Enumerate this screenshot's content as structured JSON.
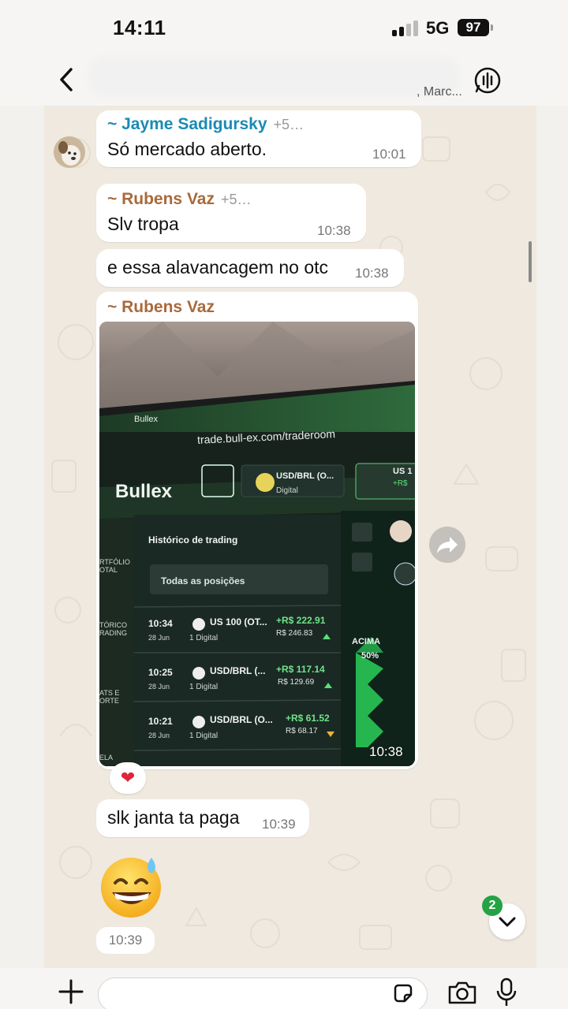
{
  "status_bar": {
    "time": "14:11",
    "network": "5G",
    "battery": "97"
  },
  "header": {
    "subtitle_fragment": ", Marc..."
  },
  "messages": [
    {
      "sender": "~ Jayme Sadigursky",
      "phone_fragment": "+5…",
      "text": "Só mercado aberto.",
      "time": "10:01"
    },
    {
      "sender": "~ Rubens Vaz",
      "phone_fragment": "+5…",
      "text": "Slv tropa",
      "time": "10:38"
    },
    {
      "text": "e essa alavancagem no otc",
      "time": "10:38"
    },
    {
      "sender": "~ Rubens Vaz",
      "time": "10:38",
      "reaction": "❤"
    },
    {
      "text": "slk janta ta paga",
      "time": "10:39"
    },
    {
      "emoji": "grinning-face-with-sweat",
      "time": "10:39"
    }
  ],
  "photo": {
    "tab_title": "Bullex",
    "url": "trade.bull-ex.com/traderoom",
    "logo": "Bullex",
    "asset_tab": {
      "name": "USD/BRL (O...",
      "type": "Digital"
    },
    "asset_tab2": {
      "name": "US 1",
      "value": "+R$"
    },
    "sidebar_labels": [
      "RTFÓLIO\nOTAL",
      "TÓRICO\nRADING",
      "ATS E\nORTE",
      "ELA"
    ],
    "panel_title": "Histórico de trading",
    "filter": "Todas as posições",
    "trades": [
      {
        "time": "10:34",
        "date": "28 Jun",
        "asset": "US 100 (OT...",
        "type": "1 Digital",
        "profit": "+R$ 222.91",
        "amount": "R$ 246.83",
        "direction": "up"
      },
      {
        "time": "10:25",
        "date": "28 Jun",
        "asset": "USD/BRL (...",
        "type": "1 Digital",
        "profit": "+R$ 117.14",
        "amount": "R$ 129.69",
        "direction": "up"
      },
      {
        "time": "10:21",
        "date": "28 Jun",
        "asset": "USD/BRL (O...",
        "type": "1 Digital",
        "profit": "+R$ 61.52",
        "amount": "R$ 68.17",
        "direction": "down"
      }
    ],
    "side_label": "ACIMA",
    "side_percent": "50%"
  },
  "scroll_badge": "2",
  "colors": {
    "sender_blue": "#1a8bb5",
    "sender_brown": "#a86a3c",
    "unread_green": "#25a244",
    "profit_green": "#6fe38a",
    "heart_red": "#e0243a"
  }
}
